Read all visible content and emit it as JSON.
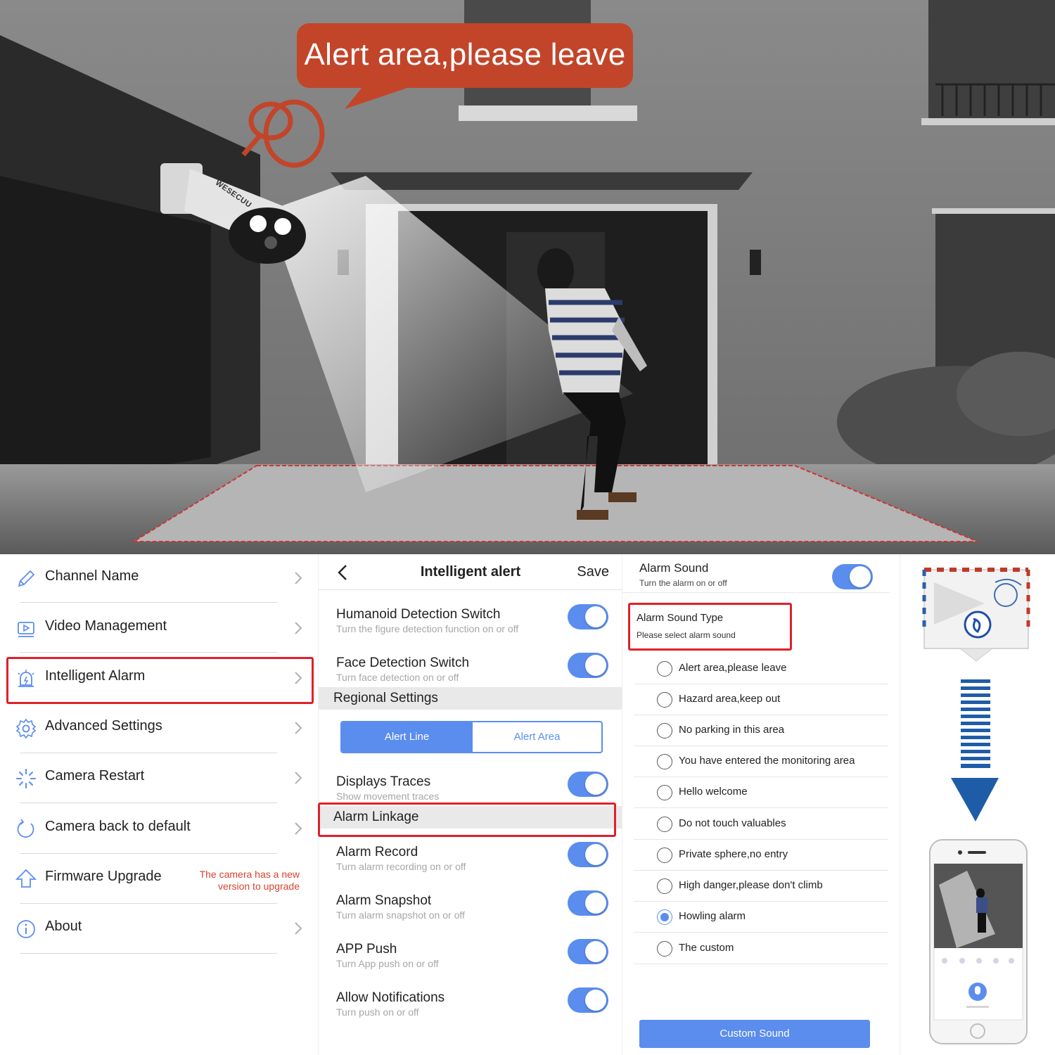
{
  "scene": {
    "speech_bubble": "Alert area,please leave",
    "camera_brand": "WESECUU"
  },
  "settings_menu": {
    "items": [
      {
        "label": "Channel Name",
        "icon": "pencil-icon"
      },
      {
        "label": "Video Management",
        "icon": "video-play-icon"
      },
      {
        "label": "Intelligent Alarm",
        "icon": "alarm-siren-icon",
        "highlighted": true
      },
      {
        "label": "Advanced Settings",
        "icon": "gear-icon"
      },
      {
        "label": "Camera Restart",
        "icon": "loading-spinner-icon"
      },
      {
        "label": "Camera back to default",
        "icon": "reset-arrow-icon"
      },
      {
        "label": "Firmware Upgrade",
        "icon": "upload-arrow-icon",
        "note": "The camera has a new version to upgrade"
      },
      {
        "label": "About",
        "icon": "info-icon"
      }
    ]
  },
  "intelligent_alert": {
    "title": "Intelligent alert",
    "save_label": "Save",
    "humanoid": {
      "title": "Humanoid Detection Switch",
      "subtitle": "Turn the figure detection function on or off",
      "on": true
    },
    "face": {
      "title": "Face Detection Switch",
      "subtitle": "Turn face detection on or off",
      "on": true
    },
    "regional_settings": "Regional Settings",
    "segment": {
      "options": [
        "Alert Line",
        "Alert Area"
      ],
      "selected": "Alert Line"
    },
    "traces": {
      "title": "Displays Traces",
      "subtitle": "Show movement traces",
      "on": true
    },
    "alarm_linkage": "Alarm Linkage",
    "record": {
      "title": "Alarm Record",
      "subtitle": "Turn alarm recording on or off",
      "on": true
    },
    "snapshot": {
      "title": "Alarm Snapshot",
      "subtitle": "Turn alarm snapshot on or off",
      "on": true
    },
    "app_push": {
      "title": "APP Push",
      "subtitle": "Turn App push on or off",
      "on": true
    },
    "notifications": {
      "title": "Allow Notifications",
      "subtitle": "Turn push on or off",
      "on": true
    }
  },
  "alarm_sound": {
    "title": "Alarm Sound",
    "subtitle": "Turn the alarm on or off",
    "on": true,
    "type_title": "Alarm Sound Type",
    "type_subtitle": "Please select alarm sound",
    "options": [
      "Alert area,please leave",
      "Hazard area,keep out",
      "No parking in this area",
      "You have entered the monitoring area",
      "Hello welcome",
      "Do not touch valuables",
      "Private sphere,no entry",
      "High danger,please don't climb",
      "Howling alarm",
      "The custom"
    ],
    "selected": "Howling alarm",
    "custom_button": "Custom Sound"
  },
  "colors": {
    "accent_blue": "#5b8def",
    "highlight_red": "#e0202a",
    "bubble_orange": "#c2452a",
    "note_red": "#d8432f"
  }
}
